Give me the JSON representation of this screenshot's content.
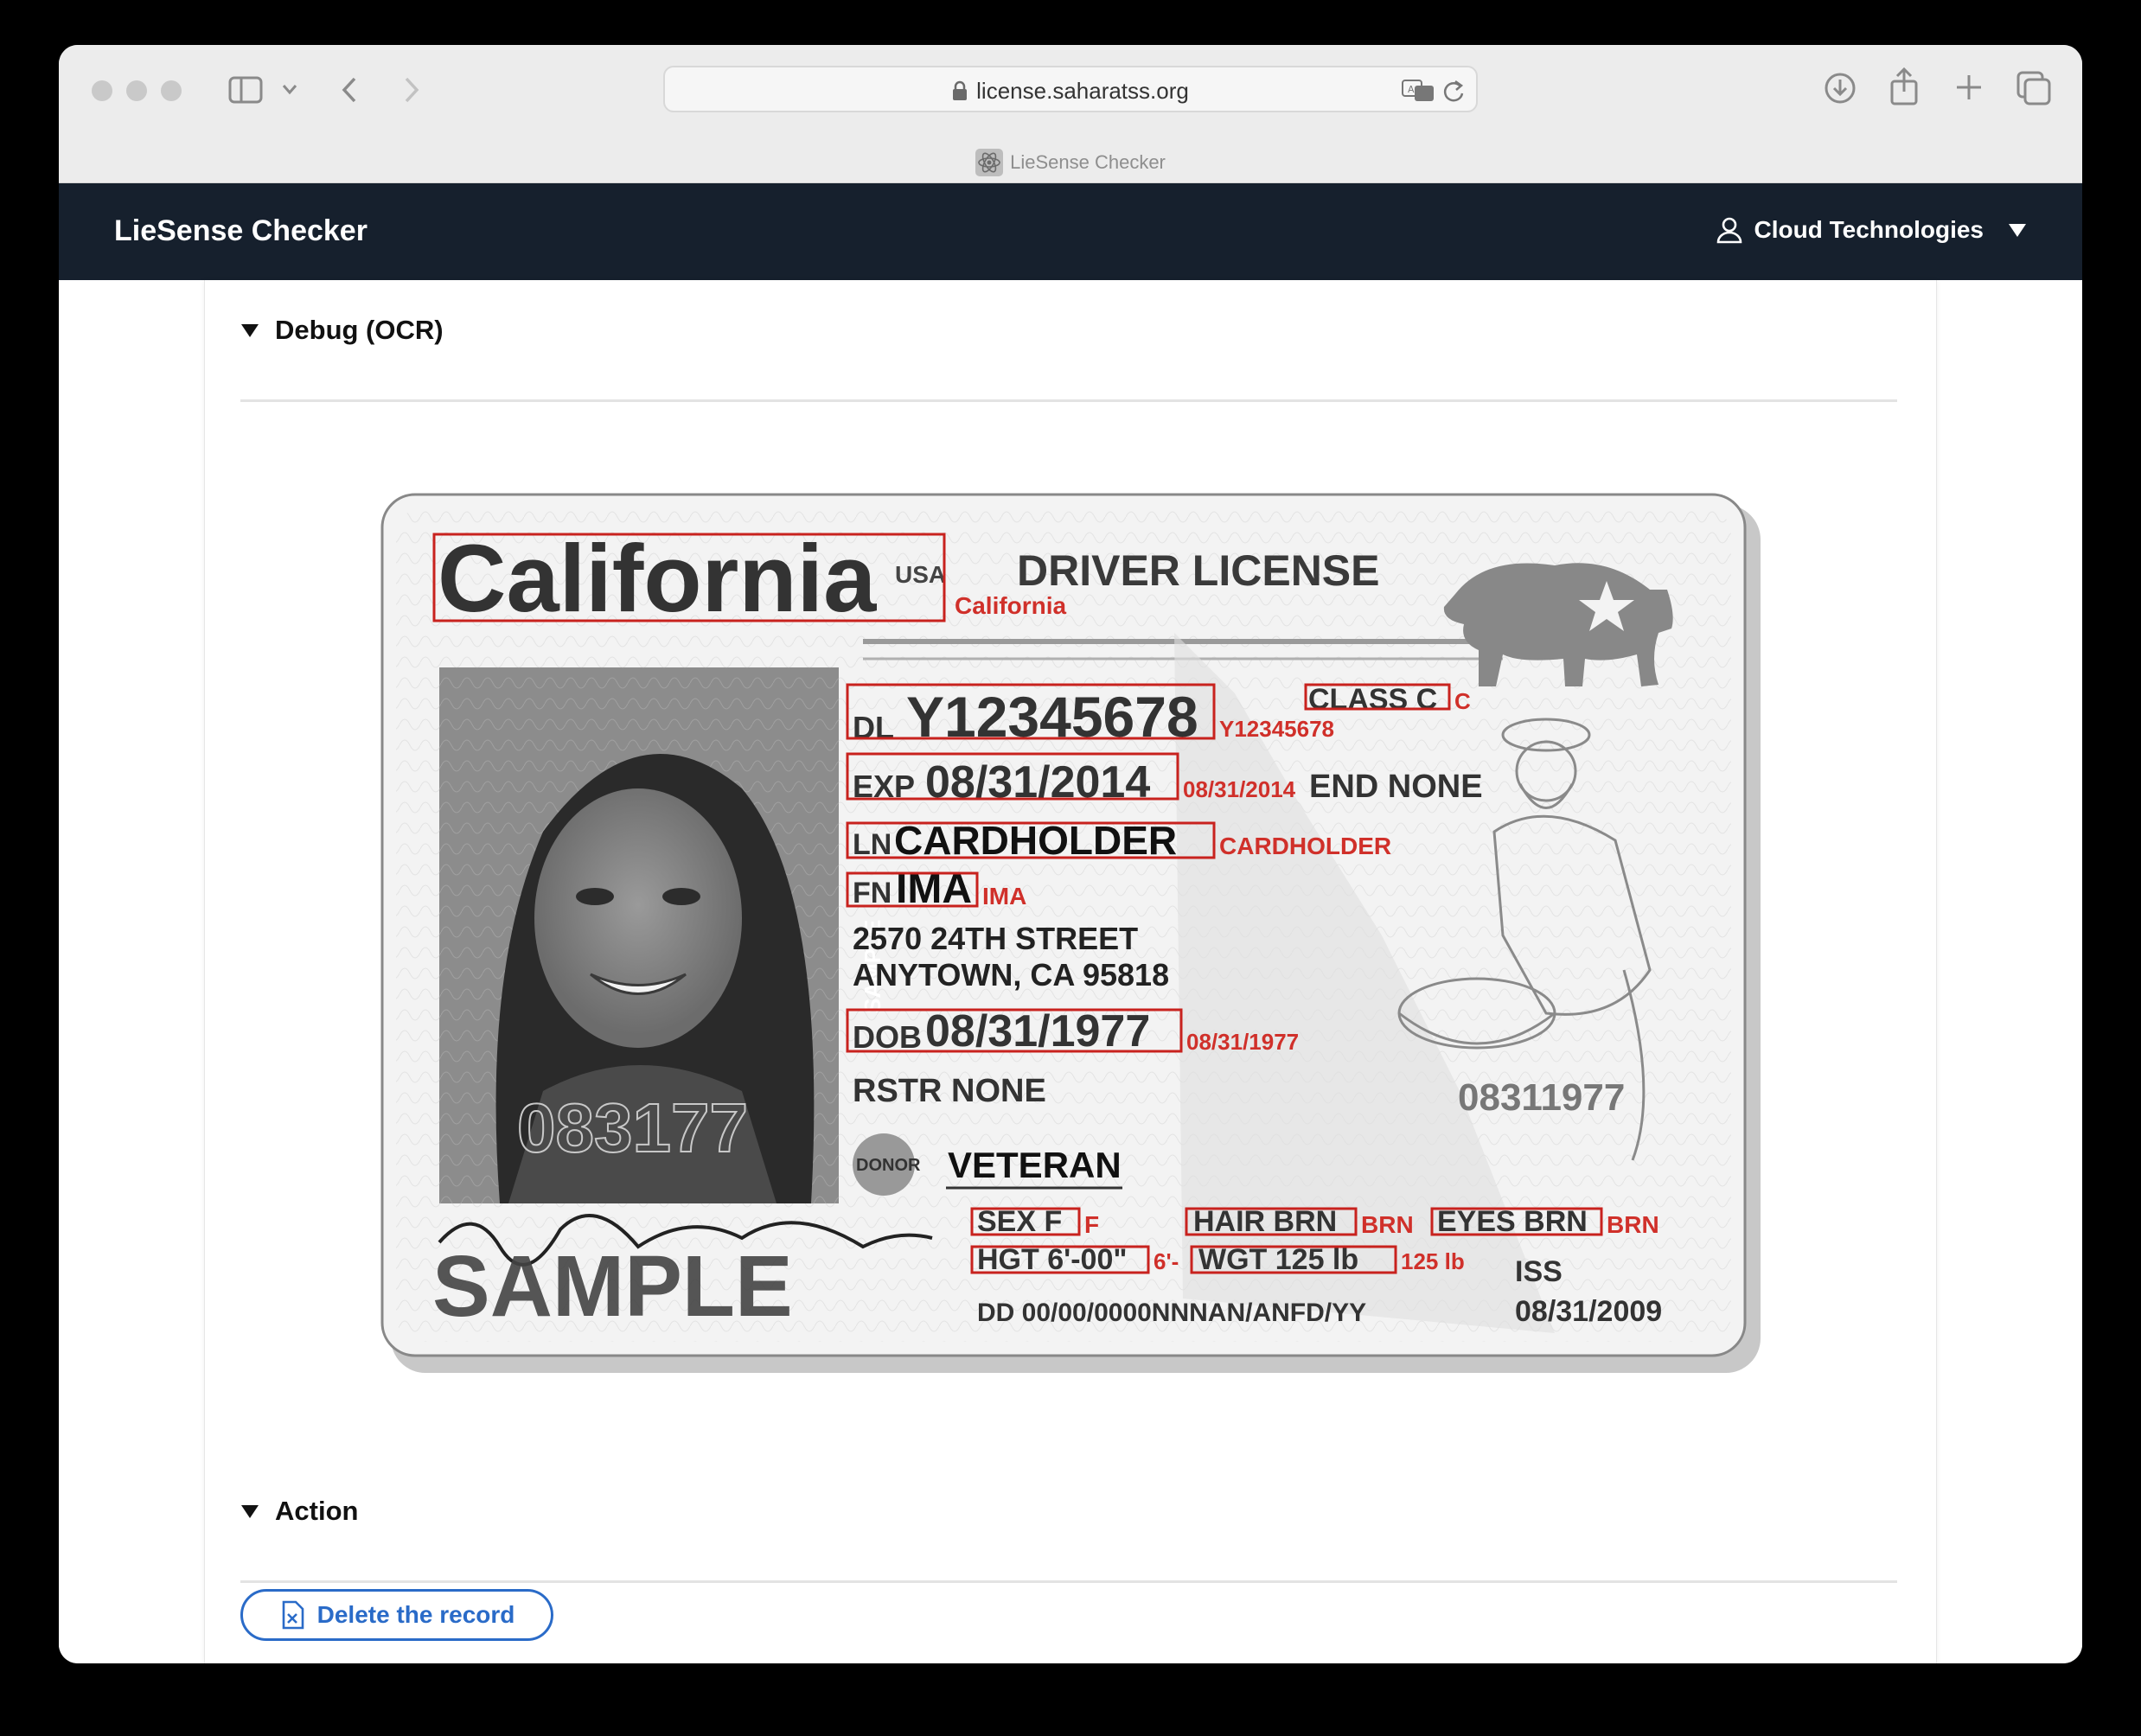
{
  "browser": {
    "url": "license.saharatss.org",
    "tab_title": "LieSense Checker"
  },
  "navbar": {
    "brand": "LieSense Checker",
    "user_name": "Cloud Technologies"
  },
  "debug_section": {
    "title": "Debug (OCR)"
  },
  "license": {
    "state": "California",
    "country": "USA",
    "heading": "DRIVER LICENSE",
    "dl_label": "DL",
    "dl_number": "Y12345678",
    "class_label": "CLASS C",
    "exp_label": "EXP",
    "exp_date": "08/31/2014",
    "end_label": "END NONE",
    "ln_label": "LN",
    "last_name": "CARDHOLDER",
    "fn_label": "FN",
    "first_name": "IMA",
    "address_1": "2570 24TH STREET",
    "address_2": "ANYTOWN, CA 95818",
    "dob_label": "DOB",
    "dob": "08/31/1977",
    "rstr": "RSTR NONE",
    "donor": "DONOR",
    "veteran": "VETERAN",
    "sex": "SEX  F",
    "hair": "HAIR  BRN",
    "eyes": "EYES BRN",
    "height": "HGT  6'-00\"",
    "weight": "WGT  125 lb",
    "dd": "DD 00/00/0000NNNAN/ANFD/YY",
    "iss_label": "ISS",
    "iss_date": "08/31/2009",
    "ghost_number": "08311977",
    "photo_ghost": "083177",
    "sample_vertical": "SAMPLE",
    "sample_watermark": "SAMPLE"
  },
  "ocr_results": {
    "state": "California",
    "dl_number": "Y12345678",
    "class": "C",
    "exp": "08/31/2014",
    "last_name": "CARDHOLDER",
    "first_name": "IMA",
    "dob": "08/31/1977",
    "sex": "F",
    "hair": "BRN",
    "eyes": "BRN",
    "height": "6'-",
    "weight": "125 lb"
  },
  "action_section": {
    "title": "Action",
    "delete_button": "Delete the record"
  },
  "colors": {
    "navbar": "#16202d",
    "ocr_red": "#c8221e",
    "button_blue": "#2a6bc8"
  }
}
